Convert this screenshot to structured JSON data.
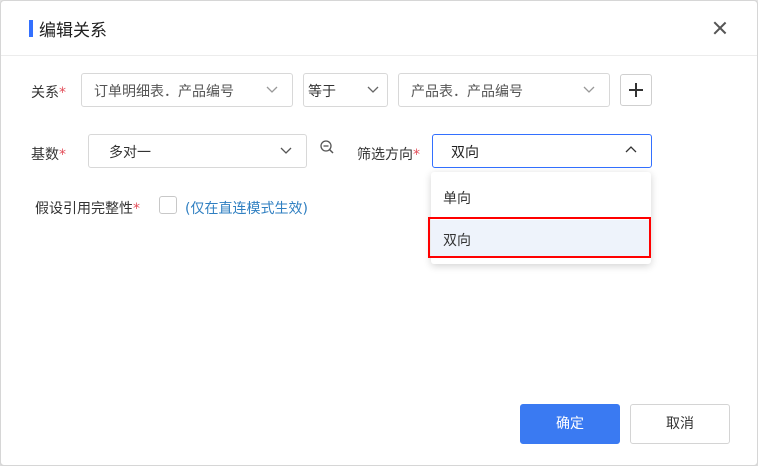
{
  "dialog": {
    "title": "编辑关系",
    "close_icon": "close-icon"
  },
  "relation": {
    "label": "关系",
    "required_mark": "*",
    "left_table_field": "订单明细表．产品编号",
    "operator": "等于",
    "right_table_field": "产品表．产品编号",
    "add_icon": "plus-icon"
  },
  "cardinality": {
    "label": "基数",
    "required_mark": "*",
    "value": "多对一",
    "zoom_icon": "zoom-out-icon"
  },
  "filter_direction": {
    "label": "筛选方向",
    "required_mark": "*",
    "value": "双向",
    "options": [
      "单向",
      "双向"
    ],
    "highlighted_option": "双向"
  },
  "integrity": {
    "label": "假设引用完整性",
    "required_mark": "*",
    "checked": false,
    "hint": "(仅在直连模式生效)"
  },
  "buttons": {
    "confirm": "确定",
    "cancel": "取消"
  },
  "colors": {
    "accent": "#3370ff",
    "primary_button": "#3a7af2",
    "required": "#e34d59",
    "hint_link": "#2f7fc1",
    "highlight_border": "#ff0000"
  }
}
